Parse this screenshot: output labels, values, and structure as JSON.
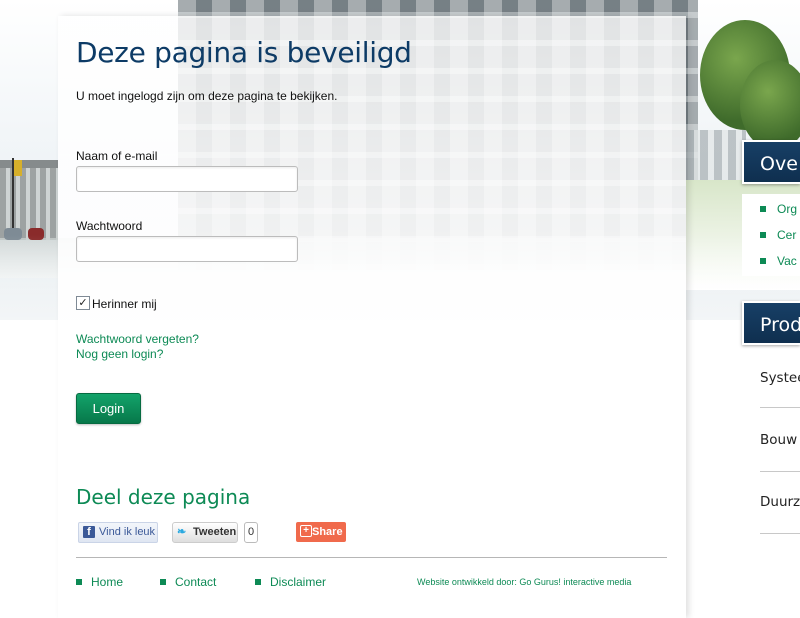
{
  "page": {
    "title": "Deze pagina is beveiligd",
    "intro": "U moet ingelogd zijn om deze pagina te bekijken."
  },
  "login_form": {
    "username_label": "Naam of e-mail",
    "username_value": "",
    "password_label": "Wachtwoord",
    "password_value": "",
    "remember_label": "Herinner mij",
    "remember_checked": true,
    "forgot_link": "Wachtwoord vergeten?",
    "no_login_link": "Nog geen login?",
    "submit_label": "Login"
  },
  "share": {
    "title": "Deel deze pagina",
    "facebook_label": "Vind ik leuk",
    "twitter_label": "Tweeten",
    "twitter_count": "0",
    "share_label": "Share"
  },
  "footer": {
    "links": [
      "Home",
      "Contact",
      "Disclaimer"
    ],
    "credit": "Website ontwikkeld door: Go Gurus! interactive media"
  },
  "sidebar": {
    "panel1_title": "Ove",
    "panel1_items": [
      "Org",
      "Cer",
      "Vac"
    ],
    "panel2_title": "Prod",
    "panel2_items": [
      "Systee",
      "Bouw",
      "Duurz"
    ]
  },
  "colors": {
    "brand_blue": "#0d3b66",
    "brand_green": "#0d8a55",
    "button_green": "#07784a",
    "panel_blue": "#173f66",
    "share_orange": "#f06a4c"
  },
  "icons": {
    "checkbox": "check-icon",
    "facebook": "facebook-icon",
    "twitter": "twitter-bird-icon",
    "share": "plus-icon",
    "bullet": "square-bullet-icon"
  }
}
